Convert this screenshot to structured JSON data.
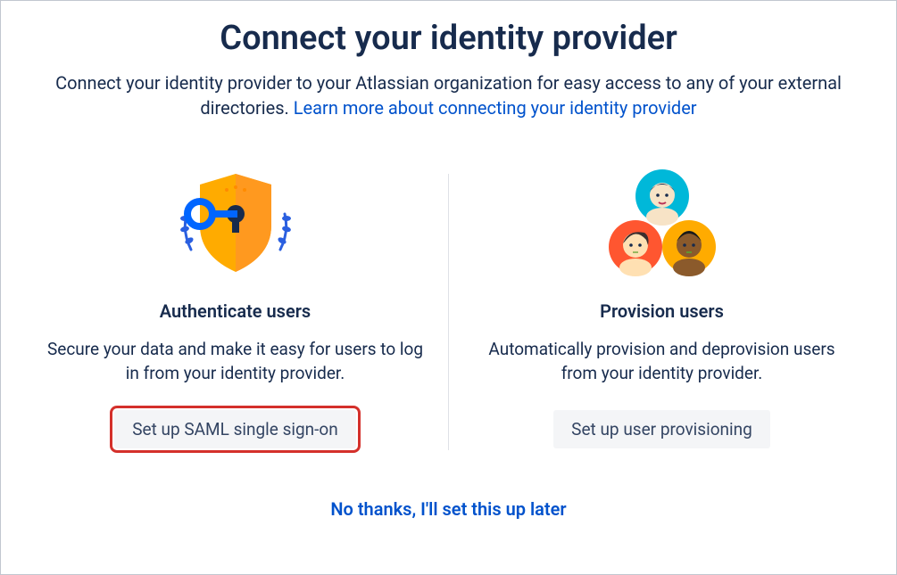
{
  "header": {
    "title": "Connect your identity provider",
    "subtitle_prefix": "Connect your identity provider to your Atlassian organization for easy access to any of your external directories. ",
    "subtitle_link": "Learn more about connecting your identity provider"
  },
  "cards": {
    "authenticate": {
      "title": "Authenticate users",
      "description": "Secure your data and make it easy for users to log in from your identity provider.",
      "button": "Set up SAML single sign-on",
      "highlighted": true
    },
    "provision": {
      "title": "Provision users",
      "description": "Automatically provision and deprovision users from your identity provider.",
      "button": "Set up user provisioning",
      "highlighted": false
    }
  },
  "footer": {
    "skip_link": "No thanks, I'll set this up later"
  }
}
